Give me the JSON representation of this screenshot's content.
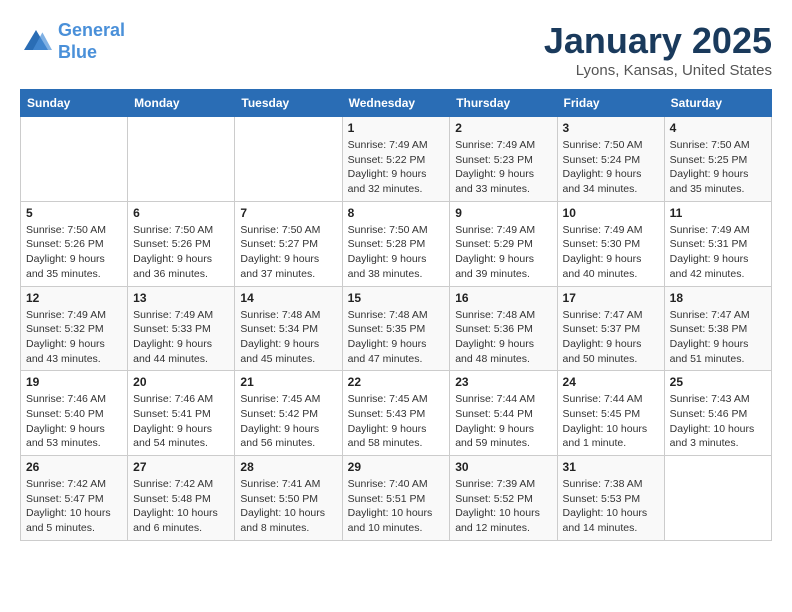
{
  "logo": {
    "line1": "General",
    "line2": "Blue"
  },
  "title": "January 2025",
  "subtitle": "Lyons, Kansas, United States",
  "days_of_week": [
    "Sunday",
    "Monday",
    "Tuesday",
    "Wednesday",
    "Thursday",
    "Friday",
    "Saturday"
  ],
  "weeks": [
    [
      {
        "day": "",
        "sunrise": "",
        "sunset": "",
        "daylight": ""
      },
      {
        "day": "",
        "sunrise": "",
        "sunset": "",
        "daylight": ""
      },
      {
        "day": "",
        "sunrise": "",
        "sunset": "",
        "daylight": ""
      },
      {
        "day": "1",
        "sunrise": "Sunrise: 7:49 AM",
        "sunset": "Sunset: 5:22 PM",
        "daylight": "Daylight: 9 hours and 32 minutes."
      },
      {
        "day": "2",
        "sunrise": "Sunrise: 7:49 AM",
        "sunset": "Sunset: 5:23 PM",
        "daylight": "Daylight: 9 hours and 33 minutes."
      },
      {
        "day": "3",
        "sunrise": "Sunrise: 7:50 AM",
        "sunset": "Sunset: 5:24 PM",
        "daylight": "Daylight: 9 hours and 34 minutes."
      },
      {
        "day": "4",
        "sunrise": "Sunrise: 7:50 AM",
        "sunset": "Sunset: 5:25 PM",
        "daylight": "Daylight: 9 hours and 35 minutes."
      }
    ],
    [
      {
        "day": "5",
        "sunrise": "Sunrise: 7:50 AM",
        "sunset": "Sunset: 5:26 PM",
        "daylight": "Daylight: 9 hours and 35 minutes."
      },
      {
        "day": "6",
        "sunrise": "Sunrise: 7:50 AM",
        "sunset": "Sunset: 5:26 PM",
        "daylight": "Daylight: 9 hours and 36 minutes."
      },
      {
        "day": "7",
        "sunrise": "Sunrise: 7:50 AM",
        "sunset": "Sunset: 5:27 PM",
        "daylight": "Daylight: 9 hours and 37 minutes."
      },
      {
        "day": "8",
        "sunrise": "Sunrise: 7:50 AM",
        "sunset": "Sunset: 5:28 PM",
        "daylight": "Daylight: 9 hours and 38 minutes."
      },
      {
        "day": "9",
        "sunrise": "Sunrise: 7:49 AM",
        "sunset": "Sunset: 5:29 PM",
        "daylight": "Daylight: 9 hours and 39 minutes."
      },
      {
        "day": "10",
        "sunrise": "Sunrise: 7:49 AM",
        "sunset": "Sunset: 5:30 PM",
        "daylight": "Daylight: 9 hours and 40 minutes."
      },
      {
        "day": "11",
        "sunrise": "Sunrise: 7:49 AM",
        "sunset": "Sunset: 5:31 PM",
        "daylight": "Daylight: 9 hours and 42 minutes."
      }
    ],
    [
      {
        "day": "12",
        "sunrise": "Sunrise: 7:49 AM",
        "sunset": "Sunset: 5:32 PM",
        "daylight": "Daylight: 9 hours and 43 minutes."
      },
      {
        "day": "13",
        "sunrise": "Sunrise: 7:49 AM",
        "sunset": "Sunset: 5:33 PM",
        "daylight": "Daylight: 9 hours and 44 minutes."
      },
      {
        "day": "14",
        "sunrise": "Sunrise: 7:48 AM",
        "sunset": "Sunset: 5:34 PM",
        "daylight": "Daylight: 9 hours and 45 minutes."
      },
      {
        "day": "15",
        "sunrise": "Sunrise: 7:48 AM",
        "sunset": "Sunset: 5:35 PM",
        "daylight": "Daylight: 9 hours and 47 minutes."
      },
      {
        "day": "16",
        "sunrise": "Sunrise: 7:48 AM",
        "sunset": "Sunset: 5:36 PM",
        "daylight": "Daylight: 9 hours and 48 minutes."
      },
      {
        "day": "17",
        "sunrise": "Sunrise: 7:47 AM",
        "sunset": "Sunset: 5:37 PM",
        "daylight": "Daylight: 9 hours and 50 minutes."
      },
      {
        "day": "18",
        "sunrise": "Sunrise: 7:47 AM",
        "sunset": "Sunset: 5:38 PM",
        "daylight": "Daylight: 9 hours and 51 minutes."
      }
    ],
    [
      {
        "day": "19",
        "sunrise": "Sunrise: 7:46 AM",
        "sunset": "Sunset: 5:40 PM",
        "daylight": "Daylight: 9 hours and 53 minutes."
      },
      {
        "day": "20",
        "sunrise": "Sunrise: 7:46 AM",
        "sunset": "Sunset: 5:41 PM",
        "daylight": "Daylight: 9 hours and 54 minutes."
      },
      {
        "day": "21",
        "sunrise": "Sunrise: 7:45 AM",
        "sunset": "Sunset: 5:42 PM",
        "daylight": "Daylight: 9 hours and 56 minutes."
      },
      {
        "day": "22",
        "sunrise": "Sunrise: 7:45 AM",
        "sunset": "Sunset: 5:43 PM",
        "daylight": "Daylight: 9 hours and 58 minutes."
      },
      {
        "day": "23",
        "sunrise": "Sunrise: 7:44 AM",
        "sunset": "Sunset: 5:44 PM",
        "daylight": "Daylight: 9 hours and 59 minutes."
      },
      {
        "day": "24",
        "sunrise": "Sunrise: 7:44 AM",
        "sunset": "Sunset: 5:45 PM",
        "daylight": "Daylight: 10 hours and 1 minute."
      },
      {
        "day": "25",
        "sunrise": "Sunrise: 7:43 AM",
        "sunset": "Sunset: 5:46 PM",
        "daylight": "Daylight: 10 hours and 3 minutes."
      }
    ],
    [
      {
        "day": "26",
        "sunrise": "Sunrise: 7:42 AM",
        "sunset": "Sunset: 5:47 PM",
        "daylight": "Daylight: 10 hours and 5 minutes."
      },
      {
        "day": "27",
        "sunrise": "Sunrise: 7:42 AM",
        "sunset": "Sunset: 5:48 PM",
        "daylight": "Daylight: 10 hours and 6 minutes."
      },
      {
        "day": "28",
        "sunrise": "Sunrise: 7:41 AM",
        "sunset": "Sunset: 5:50 PM",
        "daylight": "Daylight: 10 hours and 8 minutes."
      },
      {
        "day": "29",
        "sunrise": "Sunrise: 7:40 AM",
        "sunset": "Sunset: 5:51 PM",
        "daylight": "Daylight: 10 hours and 10 minutes."
      },
      {
        "day": "30",
        "sunrise": "Sunrise: 7:39 AM",
        "sunset": "Sunset: 5:52 PM",
        "daylight": "Daylight: 10 hours and 12 minutes."
      },
      {
        "day": "31",
        "sunrise": "Sunrise: 7:38 AM",
        "sunset": "Sunset: 5:53 PM",
        "daylight": "Daylight: 10 hours and 14 minutes."
      },
      {
        "day": "",
        "sunrise": "",
        "sunset": "",
        "daylight": ""
      }
    ]
  ]
}
